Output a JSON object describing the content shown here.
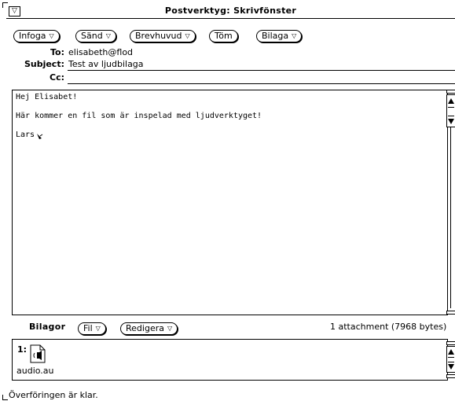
{
  "window": {
    "title": "Postverktyg: Skrivfönster",
    "menu_glyph": "▽"
  },
  "toolbar": {
    "buttons": [
      {
        "label": "Infoga",
        "glyph": "▽"
      },
      {
        "label": "Sänd",
        "glyph": "▽"
      },
      {
        "label": "Brevhuvud",
        "glyph": "▽"
      },
      {
        "label": "Töm",
        "glyph": ""
      },
      {
        "label": "Bilaga",
        "glyph": "▽"
      }
    ]
  },
  "header": {
    "to_label": "To:",
    "to_value": "elisabeth@flod",
    "subject_label": "Subject:",
    "subject_value": "Test av ljudbilaga",
    "cc_label": "Cc:",
    "cc_value": ""
  },
  "message": {
    "body": "Hej Elisabet!\n\nHär kommer en fil som är inspelad med ljudverktyget!\n\nLars"
  },
  "attachments": {
    "title": "Bilagor",
    "buttons": [
      {
        "label": "Fil",
        "glyph": "▽"
      },
      {
        "label": "Redigera",
        "glyph": "▽"
      }
    ],
    "summary": "1 attachment (7968 bytes)",
    "items": [
      {
        "index": "1:",
        "filename": "audio.au",
        "icon": "audio-file-icon"
      }
    ]
  },
  "status": "Överföringen är klar."
}
